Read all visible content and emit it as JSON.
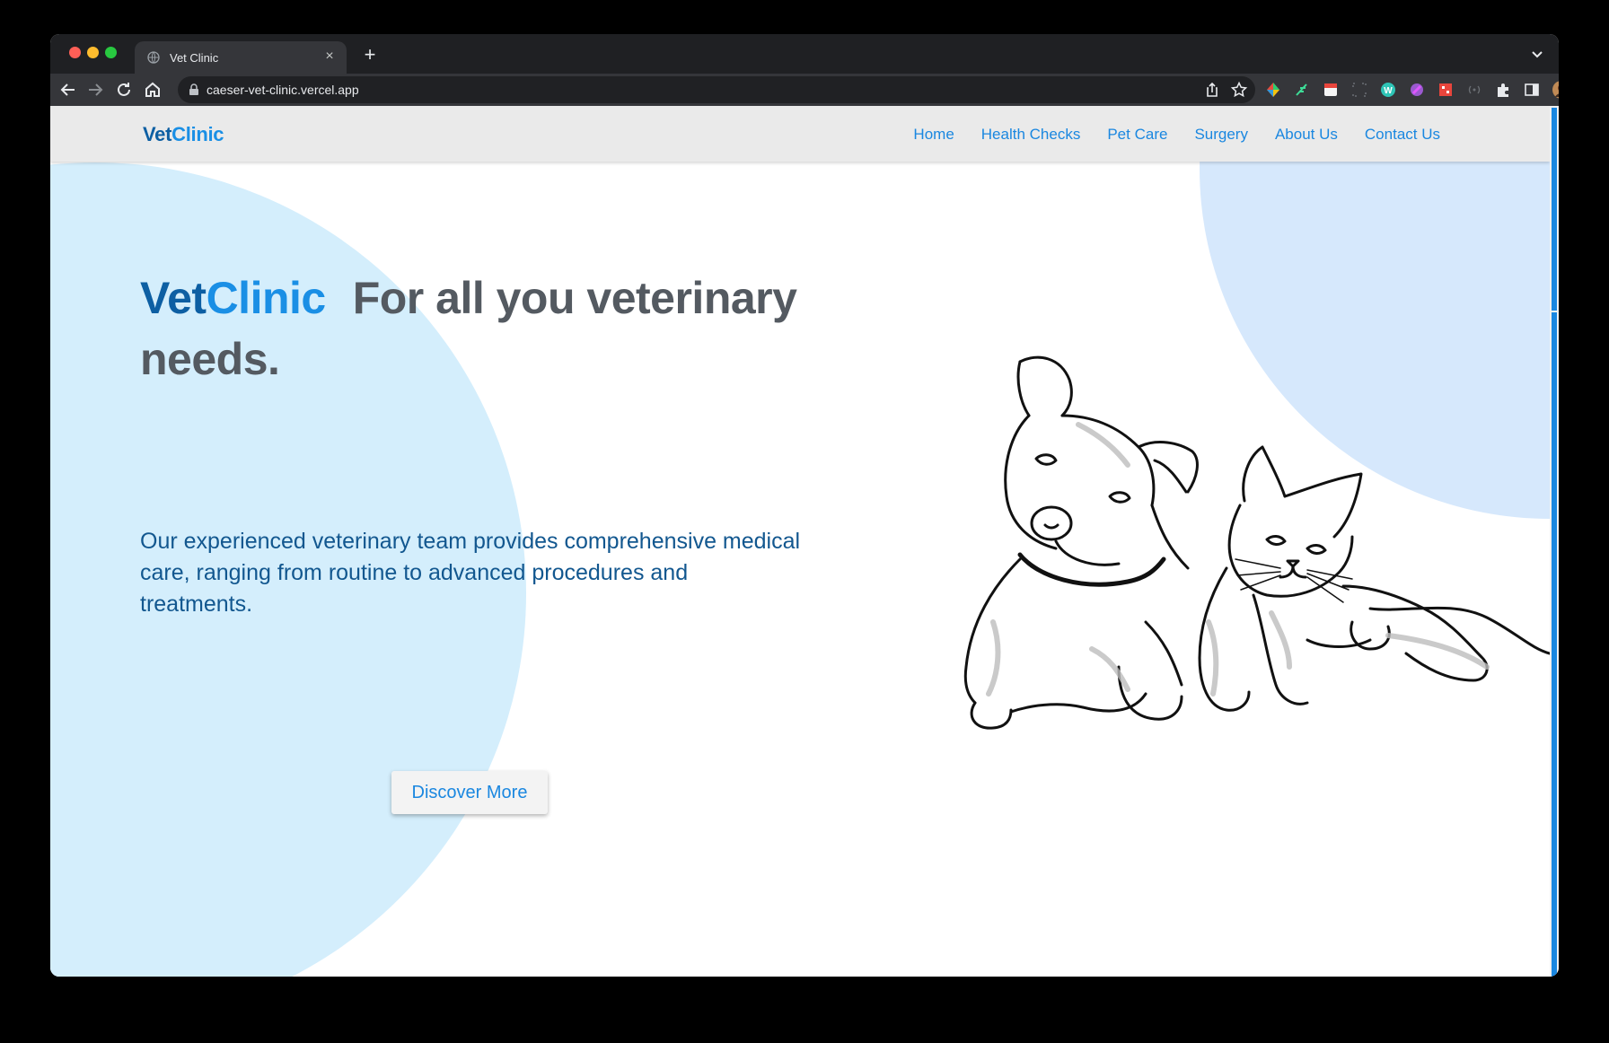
{
  "browser": {
    "tab_title": "Vet Clinic",
    "new_tab_label": "+",
    "close_label": "×",
    "url": "caeser-vet-clinic.vercel.app"
  },
  "navbar": {
    "logo_part1": "Vet",
    "logo_part2": "Clinic",
    "links": [
      "Home",
      "Health Checks",
      "Pet Care",
      "Surgery",
      "About Us",
      "Contact Us"
    ]
  },
  "hero": {
    "title_brand_part1": "Vet",
    "title_brand_part2": "Clinic",
    "title_rest": "For all you veterinary needs.",
    "description": "Our experienced veterinary team provides comprehensive medical care, ranging from routine to advanced procedures and treatments.",
    "button_label": "Discover More"
  },
  "colors": {
    "brand_dark": "#0d5fa3",
    "brand_light": "#1a8fe5",
    "link": "#1a87e0",
    "circle_left": "#d4eefc",
    "circle_right": "#d6e8fc",
    "heading_gray": "#545a61"
  },
  "icons": {
    "illustration": "dog-and-cat-line-drawing"
  }
}
